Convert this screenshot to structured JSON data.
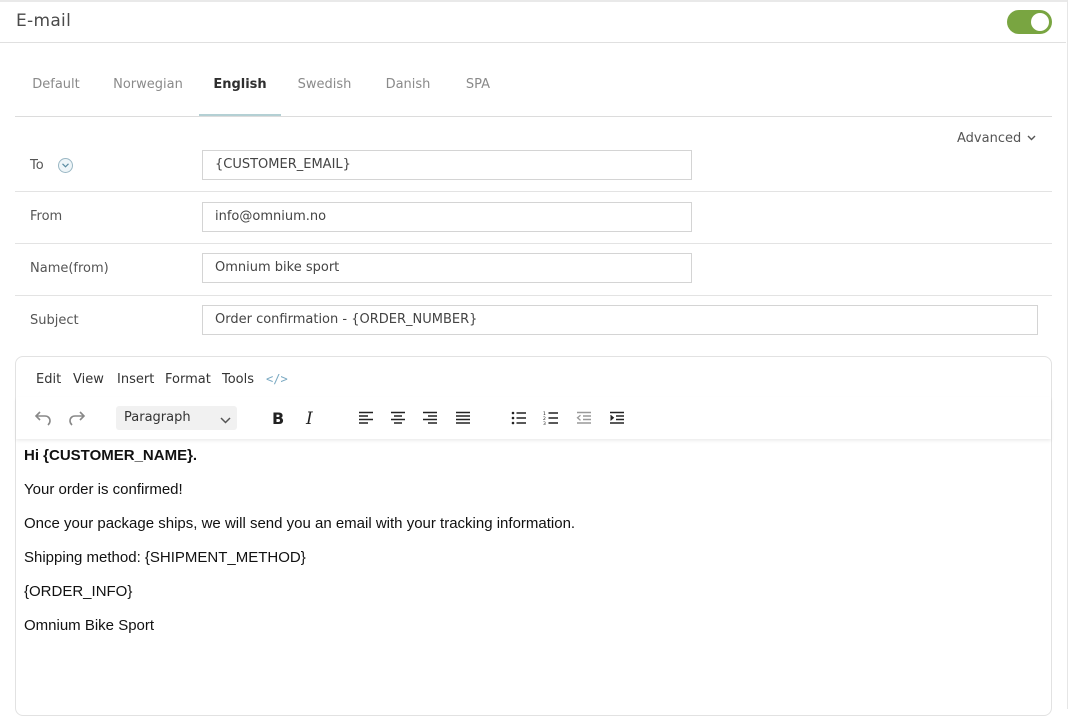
{
  "header": {
    "title": "E-mail",
    "enabled": true,
    "toggle_color": "#79a541"
  },
  "tabs": [
    {
      "label": "Default",
      "active": false
    },
    {
      "label": "Norwegian",
      "active": false
    },
    {
      "label": "English",
      "active": true
    },
    {
      "label": "Swedish",
      "active": false
    },
    {
      "label": "Danish",
      "active": false
    },
    {
      "label": "SPA",
      "active": false
    }
  ],
  "advanced": {
    "label": "Advanced"
  },
  "form": {
    "to": {
      "label": "To",
      "value": "{CUSTOMER_EMAIL}"
    },
    "from": {
      "label": "From",
      "value": "info@omnium.no"
    },
    "name_from": {
      "label": "Name(from)",
      "value": "Omnium bike sport"
    },
    "subject": {
      "label": "Subject",
      "value": "Order confirmation - {ORDER_NUMBER}"
    }
  },
  "editor": {
    "menu": [
      "Edit",
      "View",
      "Insert",
      "Format",
      "Tools"
    ],
    "block_format": "Paragraph",
    "content": [
      {
        "text": "Hi {CUSTOMER_NAME}.",
        "bold": true
      },
      {
        "text": "Your order is confirmed!",
        "bold": false
      },
      {
        "text": "Once your package ships, we will send you an email with your tracking information.",
        "bold": false
      },
      {
        "text": "Shipping method: {SHIPMENT_METHOD}",
        "bold": false
      },
      {
        "text": "{ORDER_INFO}",
        "bold": false
      },
      {
        "text": "Omnium Bike Sport",
        "bold": false
      }
    ]
  }
}
